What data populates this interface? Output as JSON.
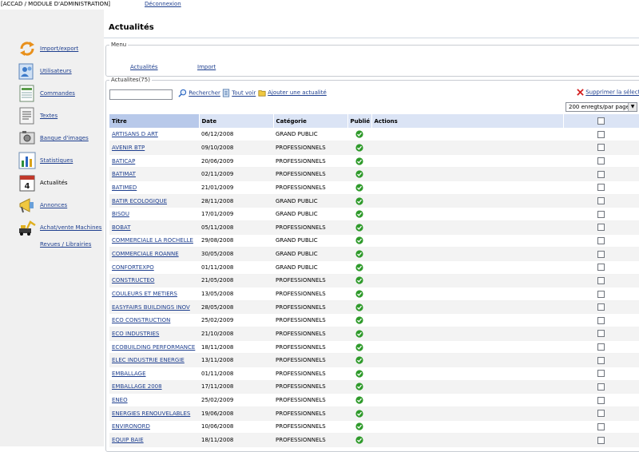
{
  "header": {
    "app_title": "[ACCAD / MODULE D'ADMINISTRATION]",
    "logout": "Déconnexion"
  },
  "sidebar": {
    "items": [
      {
        "label": "Import/export",
        "icon": "refresh-arrows-icon"
      },
      {
        "label": "Utilisateurs",
        "icon": "users-icon"
      },
      {
        "label": "Commandes",
        "icon": "orders-icon"
      },
      {
        "label": "Textes",
        "icon": "document-icon"
      },
      {
        "label": "Banque d'images",
        "icon": "image-bank-icon"
      },
      {
        "label": "Statistiques",
        "icon": "bar-chart-icon"
      },
      {
        "label": "Actualités",
        "icon": "calendar-icon"
      },
      {
        "label": "Annonces",
        "icon": "announcement-icon"
      },
      {
        "label": "Achat/vente Machines",
        "icon": "machine-icon"
      }
    ],
    "extra_link": "Revues / Librairies"
  },
  "main": {
    "title": "Actualités",
    "menu": {
      "legend": "Menu",
      "actualites": "Actualités",
      "import": "Import"
    },
    "list": {
      "legend": "Actualites(75)",
      "search_value": "",
      "search_label": "Rechercher",
      "show_all_label": "Tout voir",
      "add_label": "Ajouter une actualité",
      "delete_label": "Supprimer la sélection",
      "page_size": "200 enregts/par page"
    },
    "columns": [
      "Titre",
      "Date",
      "Catégorie",
      "Publié",
      "Actions"
    ],
    "rows": [
      {
        "title": "ARTISANS D ART",
        "date": "06/12/2008",
        "category": "GRAND PUBLIC"
      },
      {
        "title": "AVENIR BTP",
        "date": "09/10/2008",
        "category": "PROFESSIONNELS"
      },
      {
        "title": "BATICAP",
        "date": "20/06/2009",
        "category": "PROFESSIONNELS"
      },
      {
        "title": "BATIMAT",
        "date": "02/11/2009",
        "category": "PROFESSIONNELS"
      },
      {
        "title": "BATIMED",
        "date": "21/01/2009",
        "category": "PROFESSIONNELS"
      },
      {
        "title": "BATIR ECOLOGIQUE",
        "date": "28/11/2008",
        "category": "GRAND PUBLIC"
      },
      {
        "title": "BISOU",
        "date": "17/01/2009",
        "category": "GRAND PUBLIC"
      },
      {
        "title": "BOBAT",
        "date": "05/11/2008",
        "category": "PROFESSIONNELS"
      },
      {
        "title": "COMMERCIALE LA ROCHELLE",
        "date": "29/08/2008",
        "category": "GRAND PUBLIC"
      },
      {
        "title": "COMMERCIALE ROANNE",
        "date": "30/05/2008",
        "category": "GRAND PUBLIC"
      },
      {
        "title": "CONFORTEXPO",
        "date": "01/11/2008",
        "category": "GRAND PUBLIC"
      },
      {
        "title": "CONSTRUCTEO",
        "date": "21/05/2008",
        "category": "PROFESSIONNELS"
      },
      {
        "title": "COULEURS ET METIERS",
        "date": "13/05/2008",
        "category": "PROFESSIONNELS"
      },
      {
        "title": "EASYFAIRS BUILDINGS INOV",
        "date": "28/05/2008",
        "category": "PROFESSIONNELS"
      },
      {
        "title": "ECO CONSTRUCTION",
        "date": "25/02/2009",
        "category": "PROFESSIONNELS"
      },
      {
        "title": "ECO INDUSTRIES",
        "date": "21/10/2008",
        "category": "PROFESSIONNELS"
      },
      {
        "title": "ECOBUILDING PERFORMANCE",
        "date": "18/11/2008",
        "category": "PROFESSIONNELS"
      },
      {
        "title": "ELEC INDUSTRIE ENERGIE",
        "date": "13/11/2008",
        "category": "PROFESSIONNELS"
      },
      {
        "title": "EMBALLAGE",
        "date": "01/11/2008",
        "category": "PROFESSIONNELS"
      },
      {
        "title": "EMBALLAGE 2008",
        "date": "17/11/2008",
        "category": "PROFESSIONNELS"
      },
      {
        "title": "ENEO",
        "date": "25/02/2009",
        "category": "PROFESSIONNELS"
      },
      {
        "title": "ENERGIES RENOUVELABLES",
        "date": "19/06/2008",
        "category": "PROFESSIONNELS"
      },
      {
        "title": "ENVIRONORD",
        "date": "10/06/2008",
        "category": "PROFESSIONNELS"
      },
      {
        "title": "EQUIP BAIE",
        "date": "18/11/2008",
        "category": "PROFESSIONNELS"
      }
    ],
    "colors": {
      "link": "#1e3f8f",
      "header_bg": "#dbe4f5",
      "sorted_header_bg": "#b8c9ea",
      "published_green": "#2e9a2a",
      "delete_red": "#d42020"
    }
  }
}
